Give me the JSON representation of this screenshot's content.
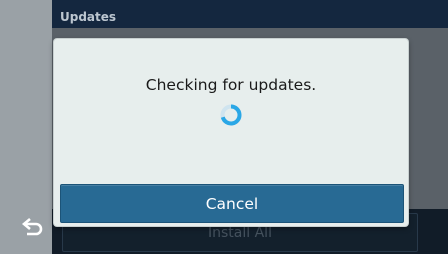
{
  "header": {
    "title": "Updates"
  },
  "dialog": {
    "message": "Checking for updates.",
    "cancel_label": "Cancel",
    "spinner_icon": "loading-spinner-icon"
  },
  "bottom_bar": {
    "install_all_label": "Install All",
    "back_icon": "back-arrow-icon"
  },
  "colors": {
    "dialog_bg": "#e7eeed",
    "cancel_bg": "#286a94",
    "header_bg": "#14273f",
    "rail_bg": "#9aa1a6",
    "spinner": "#2aa7e6"
  }
}
